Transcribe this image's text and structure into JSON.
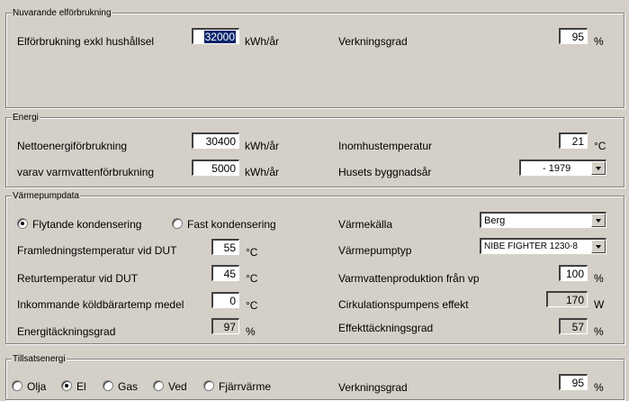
{
  "groups": {
    "current": {
      "title": "Nuvarande elförbrukning"
    },
    "energy": {
      "title": "Energi"
    },
    "heatpump": {
      "title": "Värmepumpdata"
    },
    "supplementary": {
      "title": "Tillsatsenergi"
    }
  },
  "current": {
    "consumption_label": "Elförbrukning exkl hushållsel",
    "consumption_value": "32000",
    "consumption_unit": "kWh/år",
    "efficiency_label": "Verkningsgrad",
    "efficiency_value": "95",
    "efficiency_unit": "%"
  },
  "energy": {
    "net_label": "Nettoenergiförbrukning",
    "net_value": "30400",
    "net_unit": "kWh/år",
    "hotwater_label": "varav varmvattenförbrukning",
    "hotwater_value": "5000",
    "hotwater_unit": "kWh/år",
    "indoor_label": "Inomhustemperatur",
    "indoor_value": "21",
    "indoor_unit": "°C",
    "year_label": "Husets byggnadsår",
    "year_value": "- 1979"
  },
  "heatpump": {
    "radio_floating": "Flytande kondensering",
    "radio_fixed": "Fast kondensering",
    "flow_label": "Framledningstemperatur vid DUT",
    "flow_value": "55",
    "flow_unit": "°C",
    "return_label": "Returtemperatur vid DUT",
    "return_value": "45",
    "return_unit": "°C",
    "brine_label": "Inkommande köldbärartemp medel",
    "brine_value": "0",
    "brine_unit": "°C",
    "coverage_label": "Energitäckningsgrad",
    "coverage_value": "97",
    "coverage_unit": "%",
    "source_label": "Värmekälla",
    "source_value": "Berg",
    "type_label": "Värmepumptyp",
    "type_value": "NIBE FIGHTER 1230-8",
    "hotwater_prod_label": "Varmvattenproduktion från vp",
    "hotwater_prod_value": "100",
    "hotwater_prod_unit": "%",
    "circ_label": "Cirkulationspumpens effekt",
    "circ_value": "170",
    "circ_unit": "W",
    "power_cov_label": "Effekttäckningsgrad",
    "power_cov_value": "57",
    "power_cov_unit": "%"
  },
  "supplementary": {
    "options": [
      "Olja",
      "El",
      "Gas",
      "Ved",
      "Fjärrvärme"
    ],
    "selected": "El",
    "efficiency_label": "Verkningsgrad",
    "efficiency_value": "95",
    "efficiency_unit": "%"
  }
}
